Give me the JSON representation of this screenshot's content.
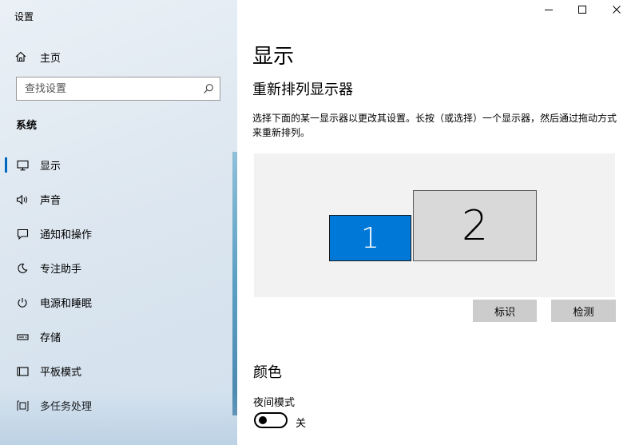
{
  "window": {
    "title": "设置"
  },
  "nav": {
    "home_label": "主页",
    "search_placeholder": "查找设置",
    "section_label": "系统",
    "items": [
      {
        "label": "显示",
        "icon": "monitor-icon",
        "selected": true
      },
      {
        "label": "声音",
        "icon": "speaker-icon"
      },
      {
        "label": "通知和操作",
        "icon": "notification-icon"
      },
      {
        "label": "专注助手",
        "icon": "moon-icon"
      },
      {
        "label": "电源和睡眠",
        "icon": "power-icon"
      },
      {
        "label": "存储",
        "icon": "storage-icon"
      },
      {
        "label": "平板模式",
        "icon": "tablet-icon"
      },
      {
        "label": "多任务处理",
        "icon": "multitask-icon"
      }
    ]
  },
  "main": {
    "page_title": "显示",
    "rearrange_title": "重新排列显示器",
    "rearrange_desc": "选择下面的某一显示器以更改其设置。长按（或选择）一个显示器，然后通过拖动方式来重新排列。",
    "monitors": [
      {
        "label": "1",
        "active": true
      },
      {
        "label": "2",
        "active": false
      }
    ],
    "identify_label": "标识",
    "detect_label": "检测",
    "color_title": "颜色",
    "night_mode_label": "夜间模式",
    "night_mode_state": "关"
  },
  "colors": {
    "accent": "#0078d7",
    "selected_indicator": "#0067c0",
    "button_bg": "#cccccc"
  }
}
